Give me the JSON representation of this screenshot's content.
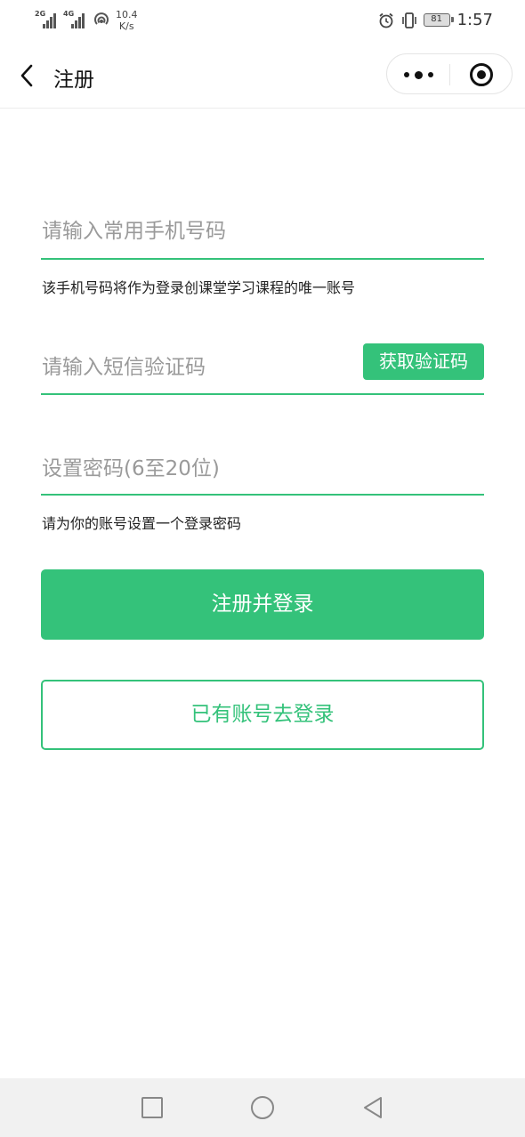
{
  "status_bar": {
    "signal1_gen": "2G",
    "signal2_gen": "4G",
    "net_speed_value": "10.4",
    "net_speed_unit": "K/s",
    "battery": "81",
    "time": "1:57",
    "icons": [
      "signal-icon",
      "signal-icon",
      "hotspot-icon",
      "alarm-icon",
      "vibrate-icon",
      "battery-icon"
    ]
  },
  "nav": {
    "title": "注册",
    "back_icon": "chevron-left-icon",
    "more_icon": "more-dots-icon",
    "close_icon": "target-circle-icon"
  },
  "form": {
    "phone_placeholder": "请输入常用手机号码",
    "phone_value": "",
    "phone_hint": "该手机号码将作为登录创课堂学习课程的唯一账号",
    "code_placeholder": "请输入短信验证码",
    "code_value": "",
    "get_code_label": "获取验证码",
    "password_placeholder": "设置密码(6至20位)",
    "password_value": "",
    "password_hint": "请为你的账号设置一个登录密码",
    "register_label": "注册并登录",
    "login_label": "已有账号去登录"
  },
  "colors": {
    "accent": "#34c27a",
    "placeholder": "#9a9a9a",
    "background": "#ffffff",
    "system_nav_bg": "#f1f1f1"
  },
  "system_nav": {
    "icons": [
      "recent-apps-icon",
      "home-icon",
      "back-triangle-icon"
    ]
  }
}
